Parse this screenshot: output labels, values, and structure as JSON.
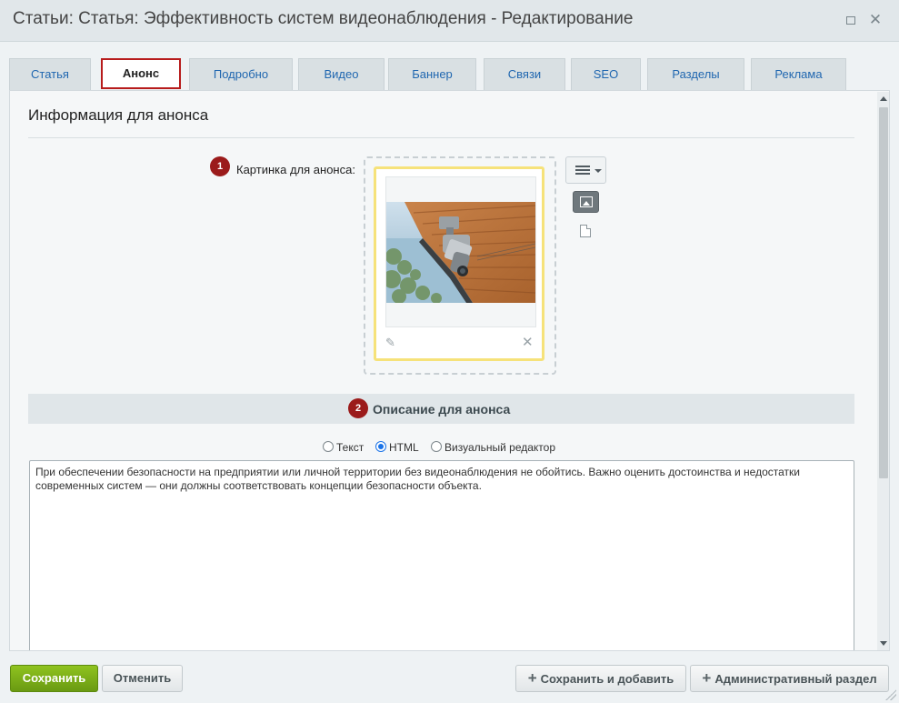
{
  "window": {
    "title": "Статьи: Статья: Эффективность систем видеонаблюдения - Редактирование",
    "close_glyph": "✕"
  },
  "tabs": [
    {
      "label": "Статья",
      "active": false
    },
    {
      "label": "Анонс",
      "active": true
    },
    {
      "label": "Подробно",
      "active": false
    },
    {
      "label": "Видео",
      "active": false
    },
    {
      "label": "Баннер",
      "active": false
    },
    {
      "label": "Связи",
      "active": false
    },
    {
      "label": "SEO",
      "active": false
    },
    {
      "label": "Разделы",
      "active": false
    },
    {
      "label": "Реклама",
      "active": false
    }
  ],
  "section": {
    "title": "Информация для анонса"
  },
  "preview_picture": {
    "badge": "1",
    "label": "Картинка для анонса:",
    "image_icon": "image-icon",
    "file_icon": "file-icon",
    "menu_icon": "menu-icon",
    "edit_glyph": "✎",
    "delete_glyph": "✕"
  },
  "preview_text": {
    "badge": "2",
    "header": "Описание для анонса",
    "modes": [
      {
        "label": "Текст",
        "checked": false
      },
      {
        "label": "HTML",
        "checked": true
      },
      {
        "label": "Визуальный редактор",
        "checked": false
      }
    ],
    "value": "При обеспечении безопасности на предприятии или личной территории без видеонаблюдения не обойтись. Важно оценить достоинства и недостатки современных систем — они должны соответствовать концепции безопасности объекта."
  },
  "footer": {
    "save": "Сохранить",
    "cancel": "Отменить",
    "save_and_add": "Сохранить и добавить",
    "admin_section": "Административный раздел",
    "plus_glyph": "+"
  },
  "colors": {
    "active_tab_border": "#b71c1c",
    "badge": "#9b1b1b",
    "save_button": "#7aad16",
    "image_card_border": "#f6e27a",
    "tab_link": "#2067b0"
  }
}
